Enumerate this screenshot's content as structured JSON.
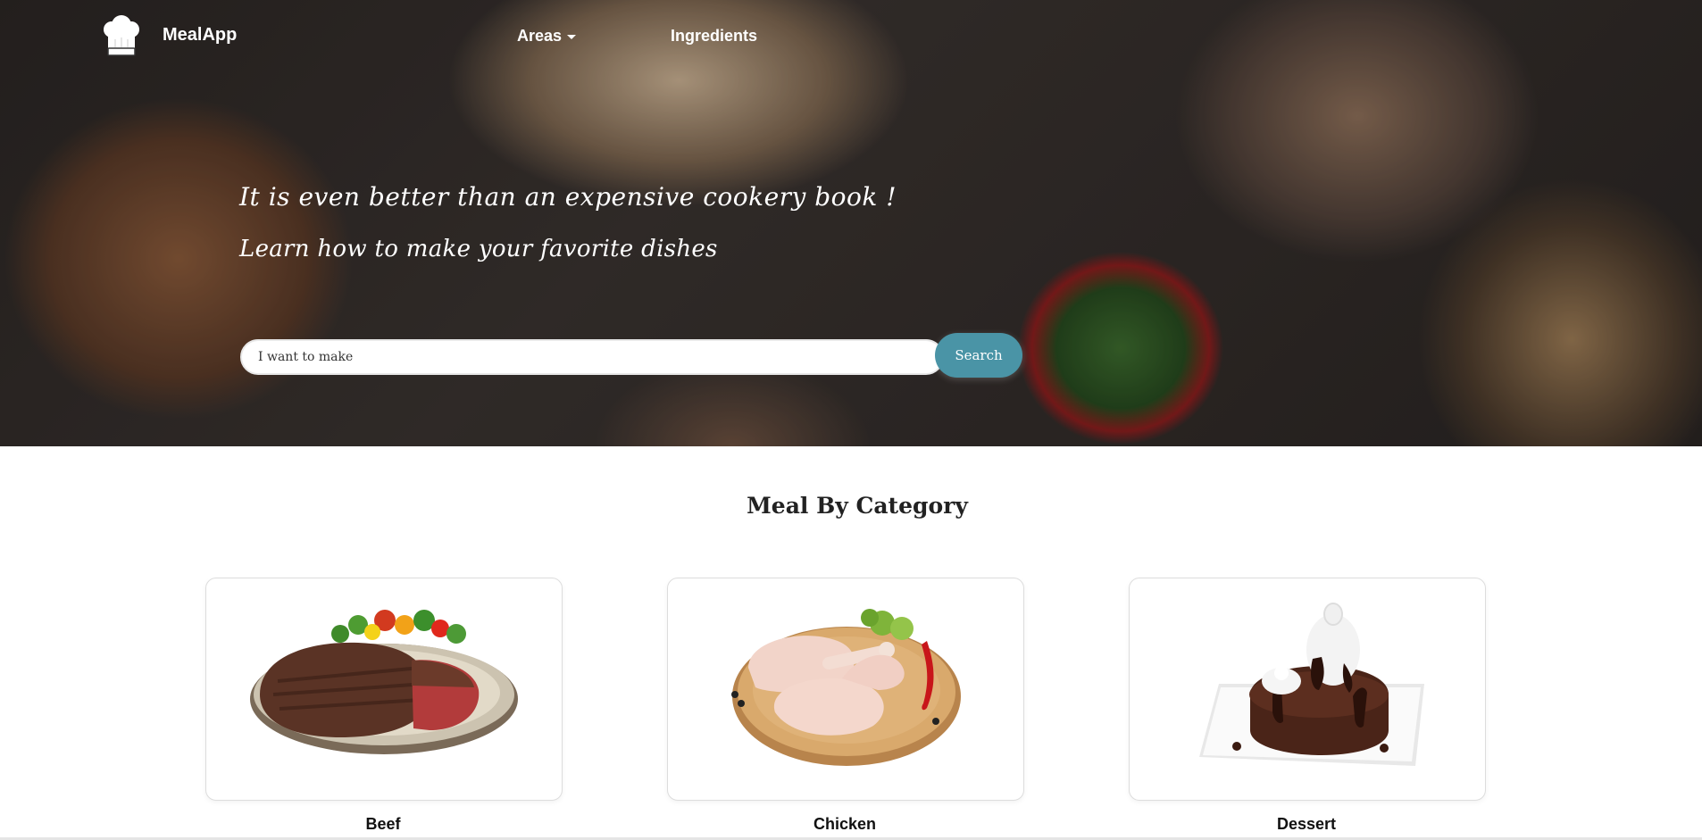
{
  "navbar": {
    "brand": "MealApp",
    "logo_icon": "chef-hat-icon",
    "links": [
      "Areas",
      "Ingredients"
    ]
  },
  "hero": {
    "headline": "It is even better than an expensive cookery book !",
    "subline": "Learn how to make your favorite dishes",
    "search": {
      "placeholder": "I want to make",
      "value": ""
    },
    "search_button": "Search",
    "accent_color": "#4a94a6"
  },
  "categories": {
    "title": "Meal By Category",
    "items": [
      {
        "label": "Beef",
        "image": "beef-steak"
      },
      {
        "label": "Chicken",
        "image": "chicken-legs"
      },
      {
        "label": "Dessert",
        "image": "chocolate-cake"
      }
    ]
  }
}
